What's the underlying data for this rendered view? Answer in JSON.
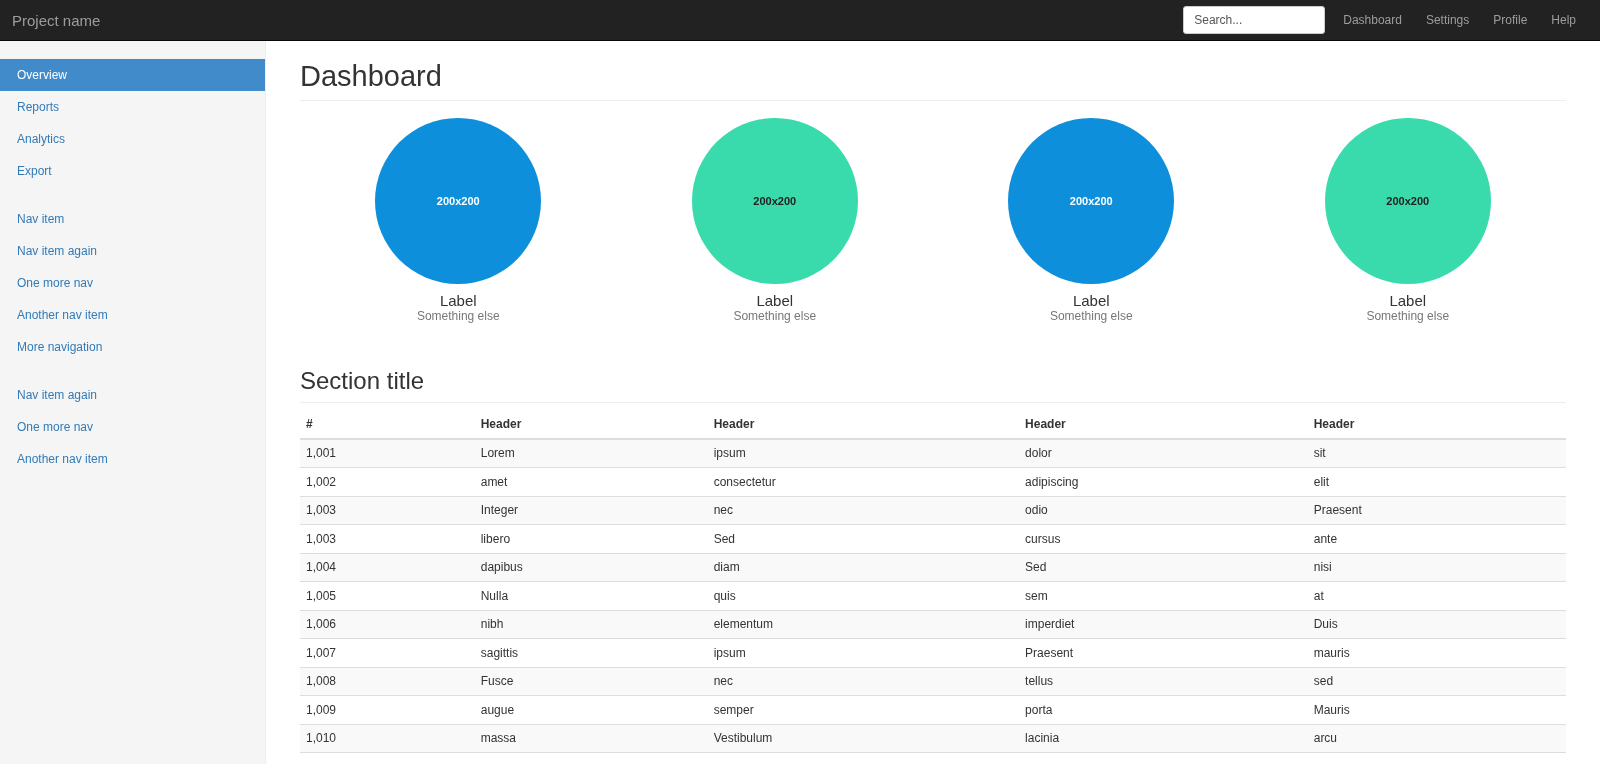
{
  "navbar": {
    "brand": "Project name",
    "search": {
      "placeholder": "Search..."
    },
    "links": [
      "Dashboard",
      "Settings",
      "Profile",
      "Help"
    ]
  },
  "sidebar": {
    "groups": [
      {
        "items": [
          {
            "label": "Overview",
            "selected": true
          },
          {
            "label": "Reports",
            "selected": false
          },
          {
            "label": "Analytics",
            "selected": false
          },
          {
            "label": "Export",
            "selected": false
          }
        ]
      },
      {
        "items": [
          {
            "label": "Nav item",
            "selected": false
          },
          {
            "label": "Nav item again",
            "selected": false
          },
          {
            "label": "One more nav",
            "selected": false
          },
          {
            "label": "Another nav item",
            "selected": false
          },
          {
            "label": "More navigation",
            "selected": false
          }
        ]
      },
      {
        "items": [
          {
            "label": "Nav item again",
            "selected": false
          },
          {
            "label": "One more nav",
            "selected": false
          },
          {
            "label": "Another nav item",
            "selected": false
          }
        ]
      }
    ]
  },
  "page_title": "Dashboard",
  "placeholders": [
    {
      "image_text": "200x200",
      "color": "#0d8fdb",
      "label": "Label",
      "caption": "Something else"
    },
    {
      "image_text": "200x200",
      "color": "#39dbac",
      "label": "Label",
      "caption": "Something else"
    },
    {
      "image_text": "200x200",
      "color": "#0d8fdb",
      "label": "Label",
      "caption": "Something else"
    },
    {
      "image_text": "200x200",
      "color": "#39dbac",
      "label": "Label",
      "caption": "Something else"
    }
  ],
  "section_title": "Section title",
  "table": {
    "columns": [
      "#",
      "Header",
      "Header",
      "Header",
      "Header"
    ],
    "rows": [
      [
        "1,001",
        "Lorem",
        "ipsum",
        "dolor",
        "sit"
      ],
      [
        "1,002",
        "amet",
        "consectetur",
        "adipiscing",
        "elit"
      ],
      [
        "1,003",
        "Integer",
        "nec",
        "odio",
        "Praesent"
      ],
      [
        "1,003",
        "libero",
        "Sed",
        "cursus",
        "ante"
      ],
      [
        "1,004",
        "dapibus",
        "diam",
        "Sed",
        "nisi"
      ],
      [
        "1,005",
        "Nulla",
        "quis",
        "sem",
        "at"
      ],
      [
        "1,006",
        "nibh",
        "elementum",
        "imperdiet",
        "Duis"
      ],
      [
        "1,007",
        "sagittis",
        "ipsum",
        "Praesent",
        "mauris"
      ],
      [
        "1,008",
        "Fusce",
        "nec",
        "tellus",
        "sed"
      ],
      [
        "1,009",
        "augue",
        "semper",
        "porta",
        "Mauris"
      ],
      [
        "1,010",
        "massa",
        "Vestibulum",
        "lacinia",
        "arcu"
      ]
    ]
  }
}
